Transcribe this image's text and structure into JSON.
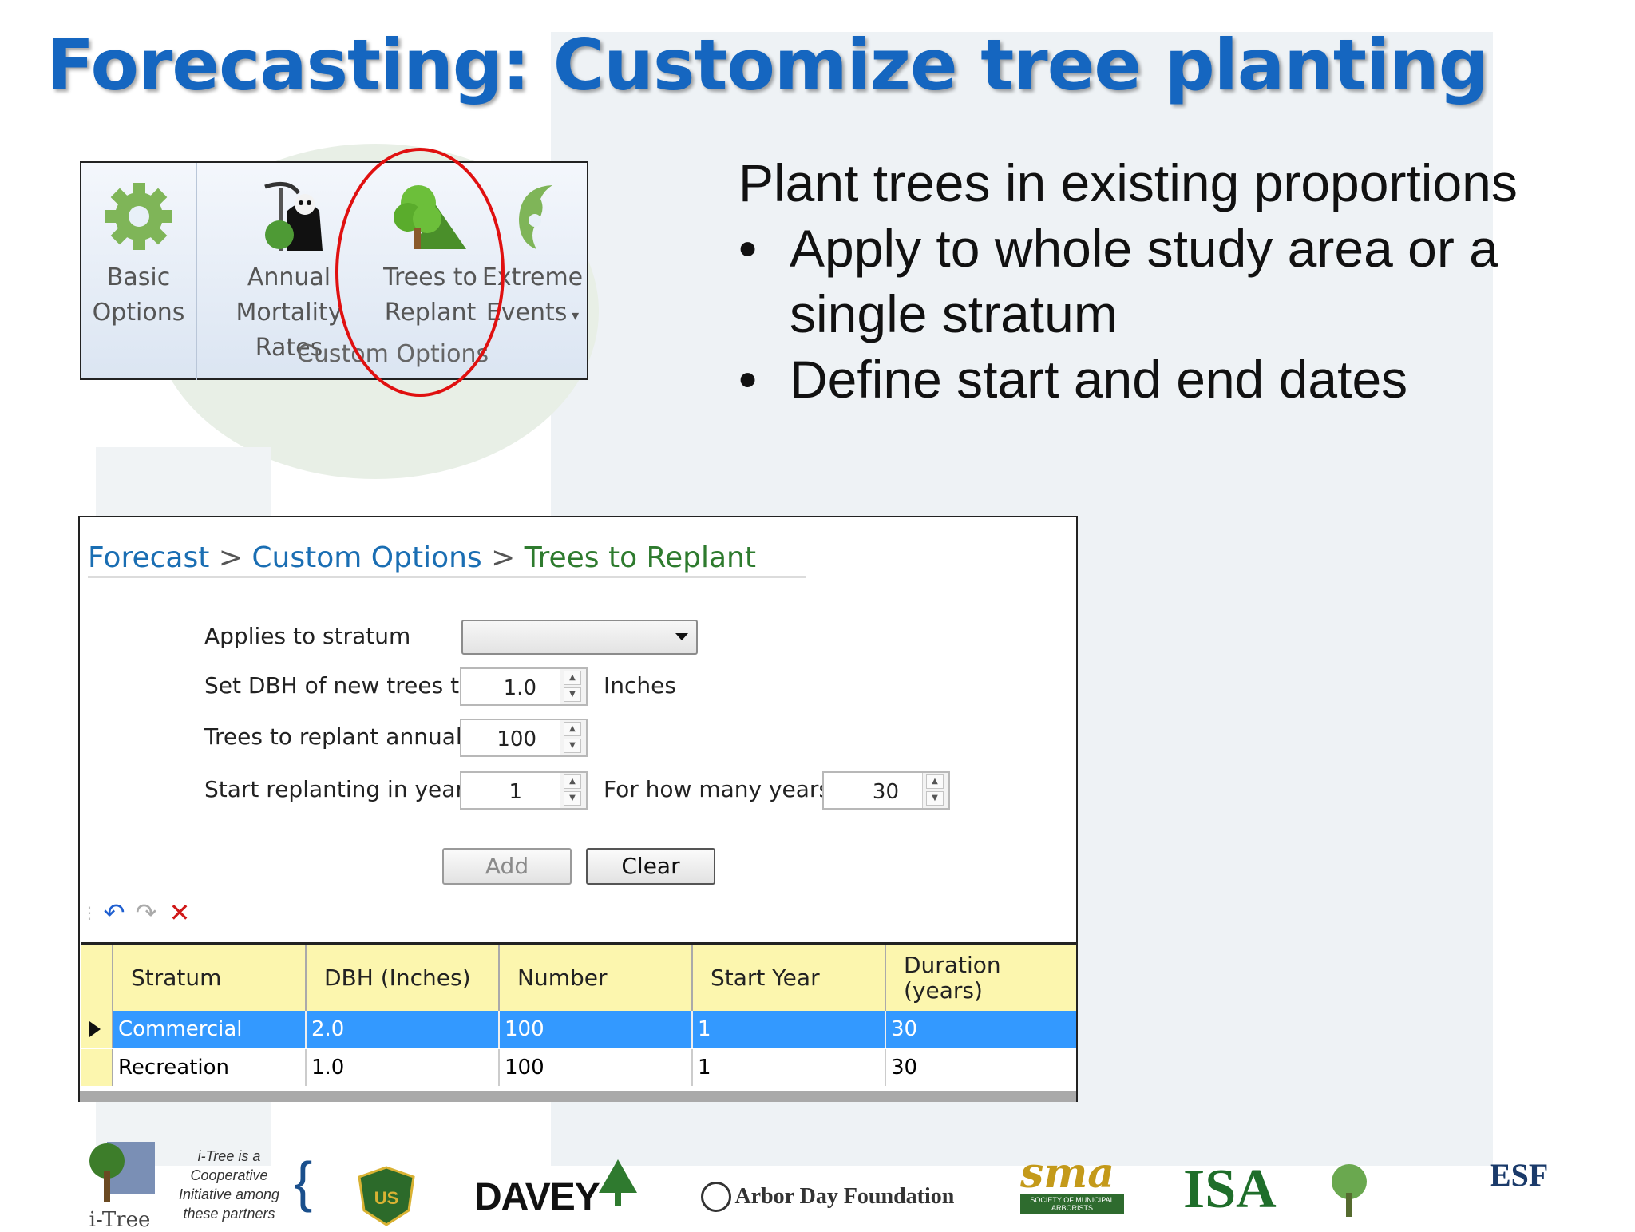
{
  "title": "Forecasting: Customize tree planting",
  "ribbon": {
    "items": [
      {
        "line1": "Basic",
        "line2": "Options"
      },
      {
        "line1": "Annual",
        "line2": "Mortality Rates"
      },
      {
        "line1": "Trees to",
        "line2": "Replant"
      },
      {
        "line1": "Extreme",
        "line2": "Events"
      }
    ],
    "group_label": "Custom Options"
  },
  "bullets": {
    "heading": "Plant trees in existing proportions",
    "items": [
      "Apply to whole study area or a single stratum",
      "Define start and end dates"
    ]
  },
  "breadcrumb": {
    "part1": "Forecast",
    "part2": "Custom Options",
    "current": "Trees to Replant",
    "sep": ">"
  },
  "form": {
    "stratum_label": "Applies to stratum",
    "stratum_value": "",
    "dbh_label": "Set DBH of new trees to",
    "dbh_value": "1.0",
    "dbh_unit": "Inches",
    "annual_label": "Trees to replant annually",
    "annual_value": "100",
    "start_label": "Start replanting in year",
    "start_value": "1",
    "years_label": "For how many years?",
    "years_value": "30",
    "add_label": "Add",
    "clear_label": "Clear"
  },
  "grid": {
    "headers": [
      "Stratum",
      "DBH (Inches)",
      "Number",
      "Start Year",
      "Duration (years)"
    ],
    "rows": [
      [
        "Commercial",
        "2.0",
        "100",
        "1",
        "30"
      ],
      [
        "Recreation",
        "1.0",
        "100",
        "1",
        "30"
      ]
    ]
  },
  "footer": {
    "itree_label": "i-Tree",
    "coop_text_1": "i-Tree is a",
    "coop_text_2": "Cooperative",
    "coop_text_3": "Initiative among",
    "coop_text_4": "these partners",
    "davey": "DAVEY",
    "arbor_day": "Arbor Day Foundation",
    "sma": "sma",
    "sma_sub": "SOCIETY OF MUNICIPAL ARBORISTS",
    "isa": "ISA",
    "esf": "ESF"
  },
  "colors": {
    "title": "#1566c0",
    "selected_row": "#3399ff",
    "grid_header": "#fcf6ae",
    "circle": "#e01010"
  }
}
